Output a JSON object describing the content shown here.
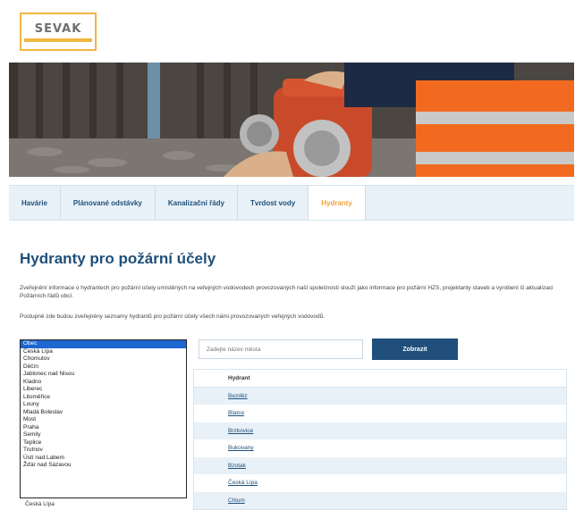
{
  "logo": {
    "text": "SEVAK"
  },
  "tabs": [
    {
      "label": "Havárie"
    },
    {
      "label": "Plánované odstávky"
    },
    {
      "label": "Kanalizační řády"
    },
    {
      "label": "Tvrdost vody"
    },
    {
      "label": "Hydranty"
    }
  ],
  "page_title": "Hydranty pro požární účely",
  "intro_text": "Zveřejnění informace o hydrantech pro požární účely umístěných na veřejných vodovodech provozovaných naší společností slouží jako informace pro požární HZS, projektanty staveb a vyrobení či aktualizaci Požárních řádů obcí.",
  "instruction_text": "Postupně zde budou zveřejněny seznamy hydrantů pro požární účely všech námi provozovaných veřejných vodovodů.",
  "select": {
    "selected": "Obec",
    "options": [
      "Obec",
      "Česká Lípa",
      "Chomutov",
      "Děčín",
      "Jablonec nad Nisou",
      "Kladno",
      "Liberec",
      "Litoměřice",
      "Louny",
      "Mladá Boleslav",
      "Most",
      "Praha",
      "Semily",
      "Teplice",
      "Trutnov",
      "Ústí nad Labem",
      "Žďár nad Sázavou"
    ],
    "below_label": "Česká Lípa"
  },
  "search": {
    "placeholder": "Zadejte název města",
    "button_label": "Zobrazit"
  },
  "table": {
    "header": "Hydrant",
    "rows": [
      "Bezděz",
      "Blatce",
      "Brzkovice",
      "Bukovany",
      "Bzotak",
      "Česká Lípa",
      "Chlum"
    ]
  },
  "colors": {
    "brand_blue": "#1f4f7a",
    "accent_orange": "#f0a23e",
    "tab_bg": "#e8f1f7"
  }
}
